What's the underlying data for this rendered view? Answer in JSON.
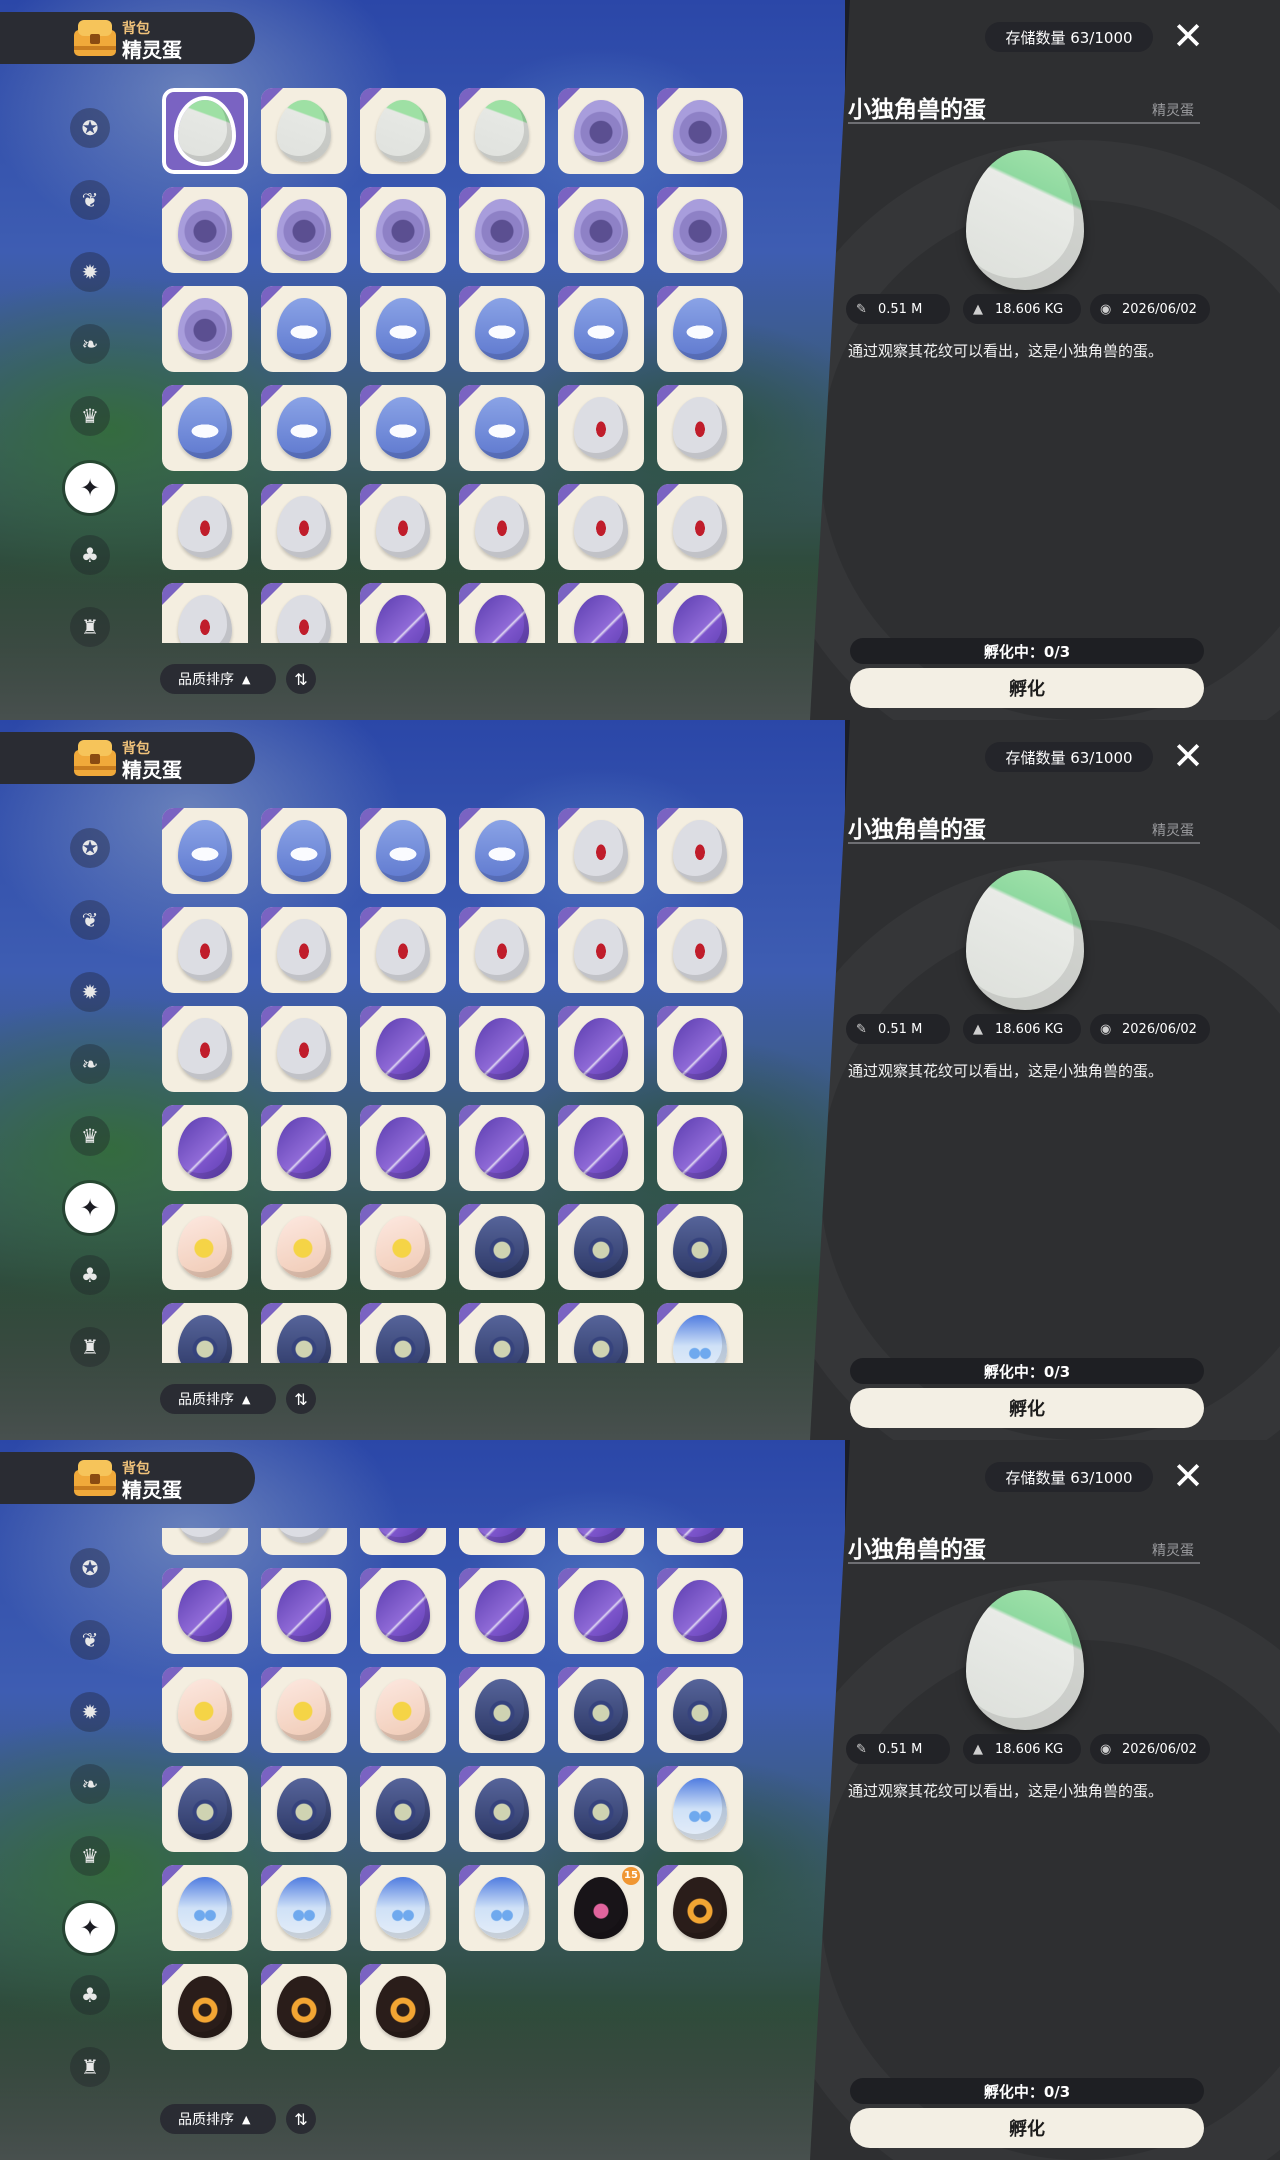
{
  "header": {
    "subtitle": "背包",
    "title": "精灵蛋",
    "icon": "chest-icon"
  },
  "sidebar": {
    "items": [
      {
        "icon": "star-badge-icon",
        "glyph": "✪",
        "active": false
      },
      {
        "icon": "leaf-icon",
        "glyph": "❦",
        "active": false
      },
      {
        "icon": "burst-icon",
        "glyph": "✹",
        "active": false
      },
      {
        "icon": "plant-icon",
        "glyph": "❧",
        "active": false
      },
      {
        "icon": "scroll-icon",
        "glyph": "♛",
        "active": false
      },
      {
        "icon": "egg-category-icon",
        "glyph": "✦",
        "active": true
      },
      {
        "icon": "acorn-icon",
        "glyph": "♣",
        "active": false
      },
      {
        "icon": "bag-icon",
        "glyph": "♜",
        "active": false
      }
    ]
  },
  "sort": {
    "label": "品质排序",
    "direction_glyph": "▲",
    "toggle_glyph": "⇅"
  },
  "storage": {
    "text": "存储数量 63/1000"
  },
  "close": {
    "glyph": "✕"
  },
  "detail": {
    "name": "小独角兽的蛋",
    "category": "精灵蛋",
    "size": "0.51 M",
    "weight": "18.606 KG",
    "date": "2026/06/02",
    "description": "通过观察其花纹可以看出，这是小独角兽的蛋。",
    "size_icon": "ruler-icon",
    "weight_icon": "weight-icon",
    "date_icon": "eye-icon"
  },
  "hatch": {
    "count_label": "孵化中：0/3",
    "button_label": "孵化"
  },
  "colors": {
    "accent_purple": "#7a63c2",
    "panel_dark": "#2e2f31",
    "tile_cream": "#f4eee0",
    "badge_orange": "#f09632"
  },
  "eggs": [
    "unicorn",
    "unicorn",
    "unicorn",
    "unicorn",
    "rock",
    "rock",
    "rock",
    "rock",
    "rock",
    "rock",
    "rock",
    "rock",
    "rock",
    "wave",
    "wave",
    "wave",
    "wave",
    "wave",
    "wave",
    "wave",
    "wave",
    "wave",
    "dot",
    "dot",
    "dot",
    "dot",
    "dot",
    "dot",
    "dot",
    "dot",
    "dot",
    "dot",
    "purple",
    "purple",
    "purple",
    "purple",
    "purple",
    "purple",
    "purple",
    "purple",
    "purple",
    "purple",
    "star",
    "star",
    "star",
    "stone",
    "stone",
    "stone",
    "stone",
    "stone",
    "stone",
    "stone",
    "stone",
    "water",
    "water",
    "water",
    "water",
    "water",
    "dark",
    "fire",
    "fire",
    "fire",
    "fire"
  ],
  "special_badge": {
    "egg_index": 58,
    "text": "15"
  },
  "views": [
    {
      "scroll_rows": 0
    },
    {
      "scroll_rows": 3
    },
    {
      "scroll_rows": 5.6
    }
  ]
}
